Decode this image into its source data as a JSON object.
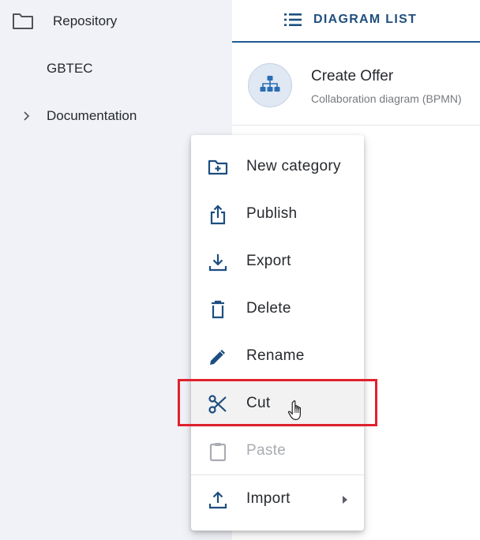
{
  "sidebar": {
    "items": [
      {
        "label": "Repository",
        "icon": "folder-icon"
      },
      {
        "label": "GBTEC"
      },
      {
        "label": "Documentation",
        "icon": "chevron-right-icon"
      }
    ]
  },
  "main": {
    "tab": {
      "label": "DIAGRAM LIST",
      "icon": "list-icon"
    },
    "diagram": {
      "title": "Create Offer",
      "subtitle": "Collaboration diagram (BPMN)",
      "icon": "org-chart-icon"
    }
  },
  "context_menu": {
    "items": [
      {
        "label": "New category",
        "icon": "new-folder-icon",
        "disabled": false
      },
      {
        "label": "Publish",
        "icon": "share-icon",
        "disabled": false
      },
      {
        "label": "Export",
        "icon": "download-icon",
        "disabled": false
      },
      {
        "label": "Delete",
        "icon": "trash-icon",
        "disabled": false
      },
      {
        "label": "Rename",
        "icon": "pencil-icon",
        "disabled": false
      },
      {
        "label": "Cut",
        "icon": "scissors-icon",
        "disabled": false,
        "highlighted": true
      },
      {
        "label": "Paste",
        "icon": "clipboard-icon",
        "disabled": true
      },
      {
        "label": "Import",
        "icon": "upload-icon",
        "disabled": false,
        "has_submenu": true
      }
    ]
  },
  "colors": {
    "accent": "#1f4f7d",
    "icon": "#1c4e80",
    "highlight": "#e0212d",
    "sidebar_bg": "#f0f2f7"
  }
}
